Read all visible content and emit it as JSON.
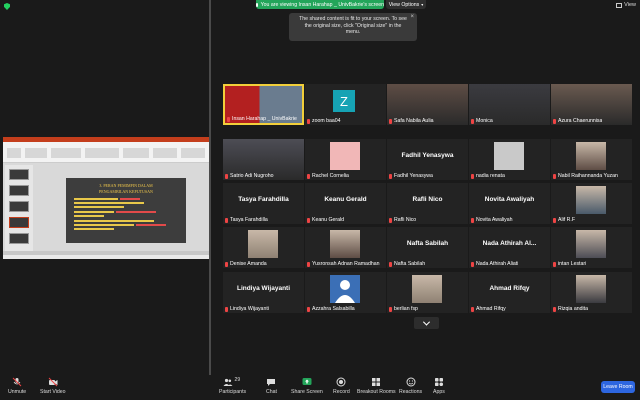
{
  "banner": {
    "text": "You are viewing Insan Harahap _ UnivBakrie's screen",
    "view_options": "View Options"
  },
  "view_button": "View",
  "tooltip": {
    "text": "The shared content is fit to your screen. To see the original size, click \"Original size\" in the menu."
  },
  "slide": {
    "title_line1": "3. PERAN PEMIMPIN DALAM",
    "title_line2": "PENGAMBILAN KEPUTUSAN"
  },
  "participants": [
    {
      "name": "Insan Harahap _ UnivBakrie",
      "type": "video",
      "active": true
    },
    {
      "name": "zoom baa04",
      "type": "letter",
      "letter": "Z"
    },
    {
      "name": "Safa Nabila Aulia",
      "type": "video"
    },
    {
      "name": "Monica",
      "type": "video"
    },
    {
      "name": "Azura Chaerunnisa",
      "type": "video"
    },
    {
      "name": "Satrio Adi Nugroho",
      "type": "video"
    },
    {
      "name": "Rachel Cornelia",
      "type": "pinkbox"
    },
    {
      "name": "Fadhil Yenasywa",
      "type": "name",
      "display": "Fadhil Yenasywa"
    },
    {
      "name": "nadia renata",
      "type": "graybox"
    },
    {
      "name": "Nabil Raihannanda Yuzan",
      "type": "avatarphoto"
    },
    {
      "name": "Tasya Farahdilla",
      "type": "name",
      "display": "Tasya Farahdilla"
    },
    {
      "name": "Keanu Gerald",
      "type": "name",
      "display": "Keanu Gerald"
    },
    {
      "name": "Rafli Nico",
      "type": "name",
      "display": "Rafli Nico"
    },
    {
      "name": "Novita Awaliyah",
      "type": "name",
      "display": "Novita Awaliyah"
    },
    {
      "name": "Alif R.F",
      "type": "avatarphoto"
    },
    {
      "name": "Denise Amanda",
      "type": "avatarphoto"
    },
    {
      "name": "Yusronsah Adnan Ramadhan",
      "type": "avatarphoto"
    },
    {
      "name": "Nafta Sabilah",
      "type": "name",
      "display": "Nafta Sabilah"
    },
    {
      "name": "Nada Athirah Aliati",
      "type": "name",
      "display": "Nada Athirah Al..."
    },
    {
      "name": "intan Lestari",
      "type": "avatarphoto"
    },
    {
      "name": "Lindiya Wijayanti",
      "type": "name",
      "display": "Lindiya Wijayanti"
    },
    {
      "name": "Azzahra Salsabilla",
      "type": "defaultavatar"
    },
    {
      "name": "berlian fsp",
      "type": "avatarphoto"
    },
    {
      "name": "Ahmad Rifqy",
      "type": "name",
      "display": "Ahmad Rifqy"
    },
    {
      "name": "Rizqia andita",
      "type": "avatarphoto"
    }
  ],
  "toolbar": {
    "unmute": "Unmute",
    "start_video": "Start Video",
    "participants": "Participants",
    "participants_count": "29",
    "chat": "Chat",
    "share_screen": "Share Screen",
    "record": "Record",
    "breakout_rooms": "Breakout Rooms",
    "reactions": "Reactions",
    "apps": "Apps",
    "leave": "Leave Room"
  },
  "colors": {
    "share_green": "#23a55a",
    "active_speaker": "#f2cf3a",
    "leave_blue": "#2d66e0"
  }
}
